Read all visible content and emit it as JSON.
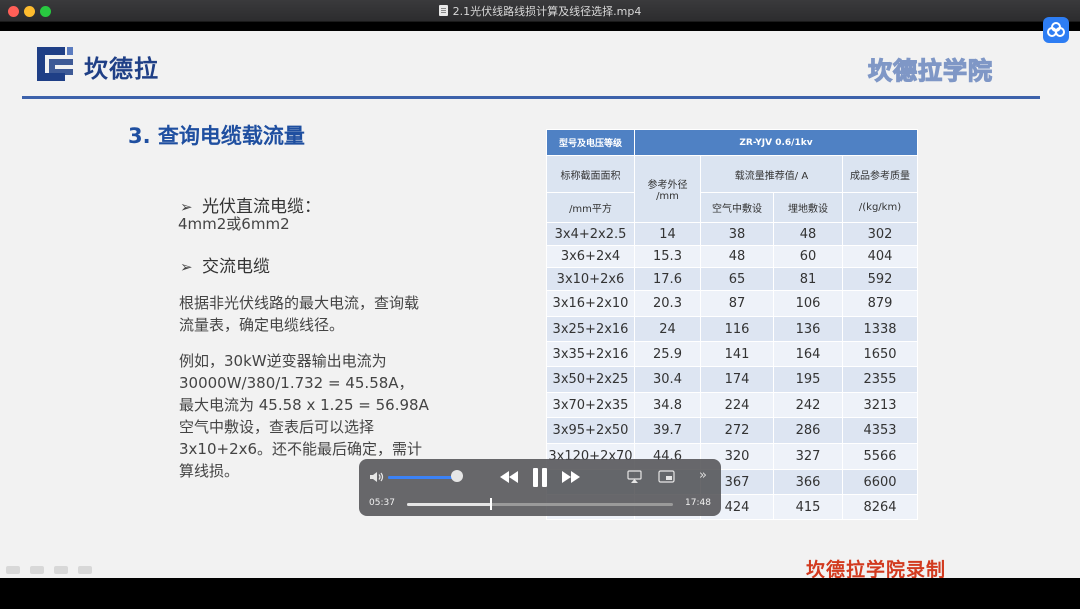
{
  "window": {
    "title": "2.1光伏线路线损计算及线径选择.mp4"
  },
  "slide": {
    "logo_text": "坎德拉",
    "academy_watermark": "坎德拉学院",
    "section_title": "3. 查询电缆载流量",
    "bullet1": "光伏直流电缆：",
    "bullet1_detail": "4mm2或6mm2",
    "bullet2": "交流电缆",
    "para1_line1": "根据非光伏线路的最大电流，查询载",
    "para1_line2": "流量表，确定电缆线径。",
    "para2_line1": "例如，30kW逆变器输出电流为",
    "para2_line2": "30000W/380/1.732 = 45.58A，",
    "para2_line3": "最大电流为 45.58 x 1.25 = 56.98A",
    "para2_line4": "空气中敷设，查表后可以选择",
    "para2_line5": "3x10+2x6。还不能最后确定，需计",
    "para2_line6": "算线损。",
    "recorded_label": "坎德拉学院录制",
    "bullet_marker": "➢"
  },
  "table": {
    "header_model": "型号及电压等级",
    "header_spec": "ZR-YJV 0.6/1kv",
    "col_section": "标称截面面积",
    "col_section_unit": "/mm平方",
    "col_diameter": "参考外径",
    "col_diameter_unit": "/mm",
    "col_current": "载流量推荐值/ A",
    "col_air": "空气中敷设",
    "col_ground": "埋地敷设",
    "col_mass": "成品参考质量",
    "col_mass_unit": "/(kg/km)",
    "rows": [
      {
        "section": "3x4+2x2.5",
        "diameter": "14",
        "air": "38",
        "ground": "48",
        "mass": "302"
      },
      {
        "section": "3x6+2x4",
        "diameter": "15.3",
        "air": "48",
        "ground": "60",
        "mass": "404"
      },
      {
        "section": "3x10+2x6",
        "diameter": "17.6",
        "air": "65",
        "ground": "81",
        "mass": "592"
      },
      {
        "section": "3x16+2x10",
        "diameter": "20.3",
        "air": "87",
        "ground": "106",
        "mass": "879"
      },
      {
        "section": "3x25+2x16",
        "diameter": "24",
        "air": "116",
        "ground": "136",
        "mass": "1338"
      },
      {
        "section": "3x35+2x16",
        "diameter": "25.9",
        "air": "141",
        "ground": "164",
        "mass": "1650"
      },
      {
        "section": "3x50+2x25",
        "diameter": "30.4",
        "air": "174",
        "ground": "195",
        "mass": "2355"
      },
      {
        "section": "3x70+2x35",
        "diameter": "34.8",
        "air": "224",
        "ground": "242",
        "mass": "3213"
      },
      {
        "section": "3x95+2x50",
        "diameter": "39.7",
        "air": "272",
        "ground": "286",
        "mass": "4353"
      },
      {
        "section": "3x120+2x70",
        "diameter": "44.6",
        "air": "320",
        "ground": "327",
        "mass": "5566"
      },
      {
        "section": "",
        "diameter": "",
        "air": "367",
        "ground": "366",
        "mass": "6600"
      },
      {
        "section": "",
        "diameter": "",
        "air": "424",
        "ground": "415",
        "mass": "8264"
      }
    ]
  },
  "player": {
    "time_current": "05:37",
    "time_total": "17:48",
    "progress_fraction": 0.316,
    "volume_fraction": 0.93,
    "more_glyph": "»"
  },
  "colors": {
    "accent_blue": "#3b82f6",
    "brand_navy": "#1f3f86",
    "title_blue": "#1f4fa0",
    "record_red": "#d23a1f"
  }
}
